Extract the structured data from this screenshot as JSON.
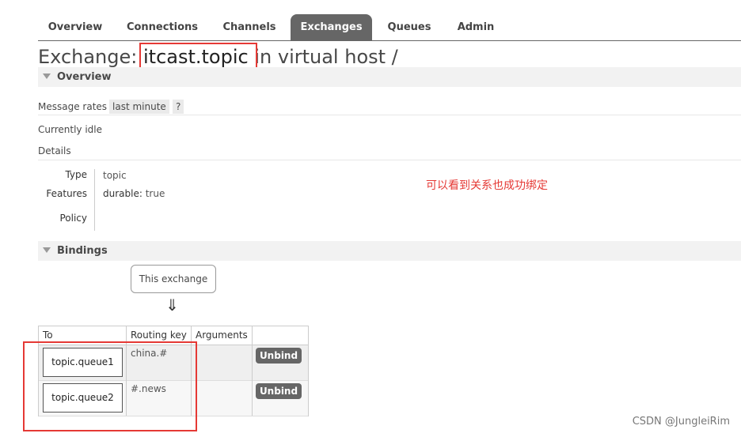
{
  "nav": {
    "tabs": [
      {
        "label": "Overview"
      },
      {
        "label": "Connections"
      },
      {
        "label": "Channels"
      },
      {
        "label": "Exchanges"
      },
      {
        "label": "Queues"
      },
      {
        "label": "Admin"
      }
    ],
    "active": "Exchanges"
  },
  "header": {
    "prefix": "Exchange:",
    "exchange_name": "itcast.topic",
    "suffix": "in virtual host /"
  },
  "overview": {
    "section_title": "Overview",
    "rates_label": "Message rates",
    "rates_period": "last minute",
    "help_label": "?",
    "status": "Currently idle",
    "details_label": "Details",
    "details": {
      "type_key": "Type",
      "type_value": "topic",
      "features_key": "Features",
      "feature_name": "durable:",
      "feature_value": "true",
      "policy_key": "Policy",
      "policy_value": ""
    }
  },
  "annotation": "可以看到关系也成功绑定",
  "bindings": {
    "section_title": "Bindings",
    "source_label": "This exchange",
    "arrow": "⇓",
    "columns": [
      "To",
      "Routing key",
      "Arguments"
    ],
    "rows": [
      {
        "to": "topic.queue1",
        "routing_key": "china.#",
        "arguments": "",
        "action": "Unbind"
      },
      {
        "to": "topic.queue2",
        "routing_key": "#.news",
        "arguments": "",
        "action": "Unbind"
      }
    ]
  },
  "watermark": "CSDN @JungleiRim",
  "colors": {
    "accent_red": "#e53935",
    "nav_active": "#666666",
    "section_bg": "#f2f2f2"
  }
}
